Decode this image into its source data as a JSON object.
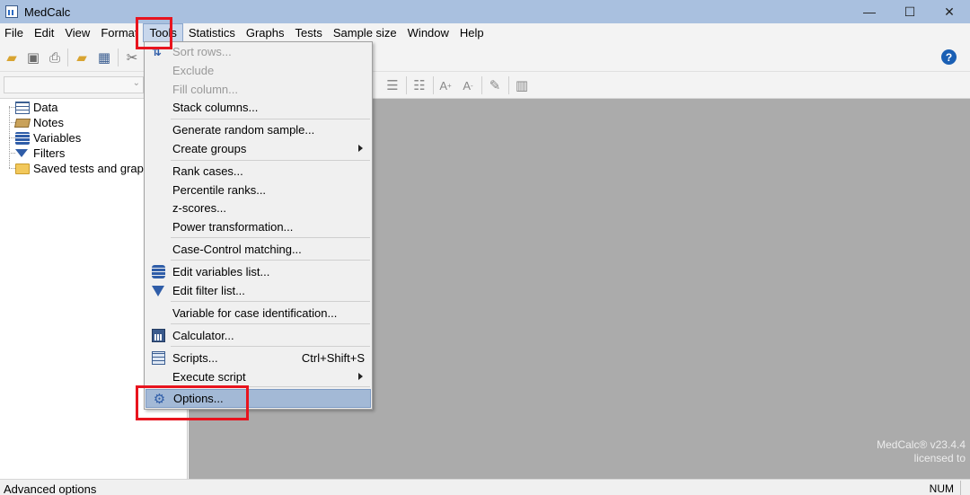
{
  "window": {
    "title": "MedCalc",
    "minimize": "—",
    "maximize": "☐",
    "close": "✕"
  },
  "menubar": [
    "File",
    "Edit",
    "View",
    "Format",
    "Tools",
    "Statistics",
    "Graphs",
    "Tests",
    "Sample size",
    "Window",
    "Help"
  ],
  "menubar_active": "Tools",
  "tree": {
    "items": [
      {
        "label": "Data",
        "icon": "data-table-icon"
      },
      {
        "label": "Notes",
        "icon": "notes-icon"
      },
      {
        "label": "Variables",
        "icon": "variables-icon"
      },
      {
        "label": "Filters",
        "icon": "filter-icon"
      },
      {
        "label": "Saved tests and graphs",
        "icon": "folder-icon"
      }
    ]
  },
  "tools_menu": {
    "items": [
      {
        "label": "Sort rows...",
        "disabled": true,
        "icon": "sort-icon"
      },
      {
        "label": "Exclude",
        "disabled": true
      },
      {
        "label": "Fill column...",
        "disabled": true
      },
      {
        "label": "Stack columns..."
      },
      {
        "label": "Generate random sample..."
      },
      {
        "label": "Create groups",
        "submenu": true
      },
      {
        "label": "Rank cases..."
      },
      {
        "label": "Percentile ranks..."
      },
      {
        "label": "z-scores..."
      },
      {
        "label": "Power transformation..."
      },
      {
        "label": "Case-Control matching..."
      },
      {
        "label": "Edit variables list...",
        "icon": "variables-icon"
      },
      {
        "label": "Edit filter list...",
        "icon": "filter-icon"
      },
      {
        "label": "Variable for case identification..."
      },
      {
        "label": "Calculator...",
        "icon": "calculator-icon"
      },
      {
        "label": "Scripts...",
        "shortcut": "Ctrl+Shift+S",
        "icon": "scripts-icon"
      },
      {
        "label": "Execute script",
        "submenu": true
      },
      {
        "label": "Options...",
        "icon": "gear-icon",
        "highlighted": true
      }
    ]
  },
  "watermark": {
    "line1": "MedCalc® v23.4.4",
    "line2": "licensed to"
  },
  "statusbar": {
    "text": "Advanced options",
    "num": "NUM"
  },
  "colors": {
    "titlebar": "#a9c0df",
    "highlight_box": "#e8141e",
    "workspace": "#ababab"
  }
}
